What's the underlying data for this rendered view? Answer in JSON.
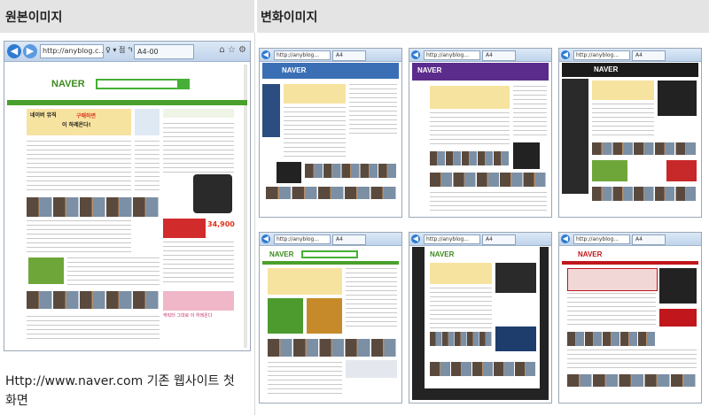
{
  "headers": {
    "original": "원본이미지",
    "transformed": "변화이미지"
  },
  "caption": "Http://www.naver.com 기존 웹사이트 첫화면",
  "original_window": {
    "address": "http://anyblog.c...",
    "address_icons": "♀ ▾ 점 ℃ ×",
    "tab_title": "A4-00",
    "logo": "NAVER",
    "banner_text": "네이버 뮤직",
    "banner_highlight": "구매하면",
    "banner_sub": "이 하레온다!",
    "price": "34,900",
    "bottom_text": "캐릭터 그대로 이 하레온다"
  },
  "transformed_windows": [
    {
      "address": "http://anyblog...",
      "tab_title": "A4",
      "logo": "NAVER",
      "theme": "blue"
    },
    {
      "address": "http://anyblog...",
      "tab_title": "A4",
      "logo": "NAVER",
      "theme": "purple"
    },
    {
      "address": "http://anyblog...",
      "tab_title": "A4",
      "logo": "NAVER",
      "theme": "dark"
    },
    {
      "address": "http://anyblog...",
      "tab_title": "A4",
      "logo": "NAVER",
      "theme": "green-large"
    },
    {
      "address": "http://anyblog...",
      "tab_title": "A4",
      "logo": "NAVER",
      "theme": "black"
    },
    {
      "address": "http://anyblog...",
      "tab_title": "A4",
      "logo": "NAVER",
      "theme": "red"
    }
  ],
  "colors": {
    "naver_green": "#45b035",
    "header_bg": "#e4e4e4",
    "chrome_blue": "#2f7bd3"
  }
}
